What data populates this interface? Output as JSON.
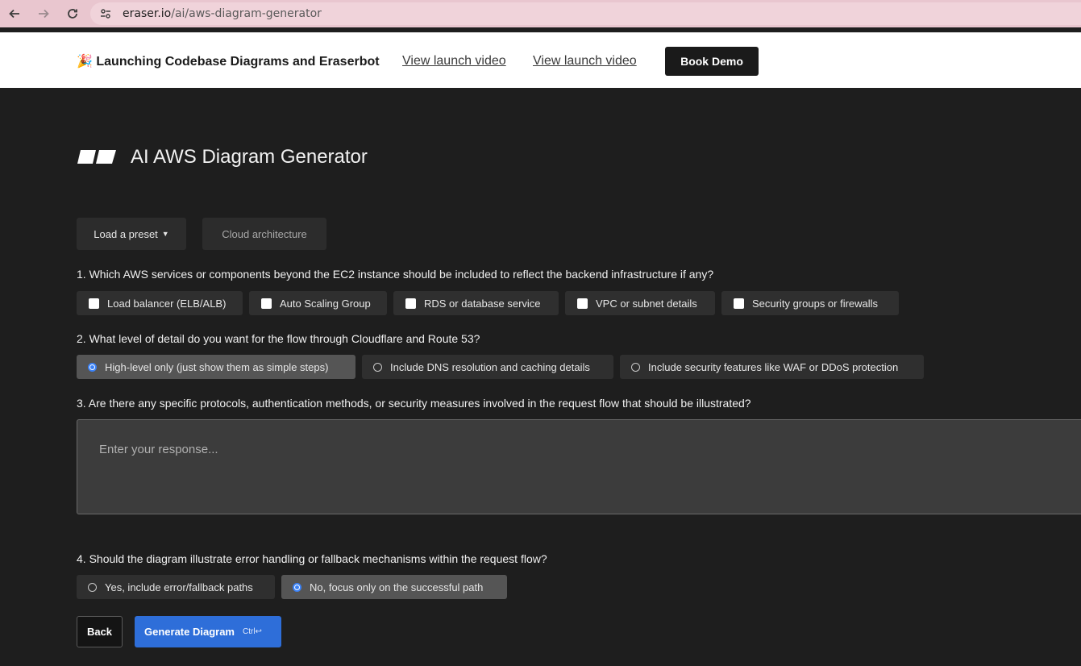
{
  "browser": {
    "url_domain": "eraser.io",
    "url_path": "/ai/aws-diagram-generator"
  },
  "announcement": {
    "emoji": "🎉",
    "text": "Launching Codebase Diagrams and Eraserbot",
    "link1": "View launch video",
    "link2": "View launch video",
    "cta": "Book Demo"
  },
  "page": {
    "title": "AI AWS Diagram Generator",
    "preset_label": "Load a preset",
    "preset_value": "Cloud architecture"
  },
  "questions": {
    "q1": {
      "text": "1. Which AWS services or components beyond the EC2 instance should be included to reflect the backend infrastructure if any?",
      "options": [
        "Load balancer (ELB/ALB)",
        "Auto Scaling Group",
        "RDS or database service",
        "VPC or subnet details",
        "Security groups or firewalls"
      ]
    },
    "q2": {
      "text": "2. What level of detail do you want for the flow through Cloudflare and Route 53?",
      "options": [
        "High-level only (just show them as simple steps)",
        "Include DNS resolution and caching details",
        "Include security features like WAF or DDoS protection"
      ],
      "selected": 0
    },
    "q3": {
      "text": "3. Are there any specific protocols, authentication methods, or security measures involved in the request flow that should be illustrated?",
      "placeholder": "Enter your response..."
    },
    "q4": {
      "text": "4. Should the diagram illustrate error handling or fallback mechanisms within the request flow?",
      "options": [
        "Yes, include error/fallback paths",
        "No, focus only on the successful path"
      ],
      "selected": 1
    }
  },
  "actions": {
    "back": "Back",
    "generate": "Generate Diagram",
    "shortcut": "Ctrl↩"
  },
  "colors": {
    "accent": "#2e6ed9",
    "background": "#1e1e1e",
    "browser_bar": "#e9c6cf"
  }
}
